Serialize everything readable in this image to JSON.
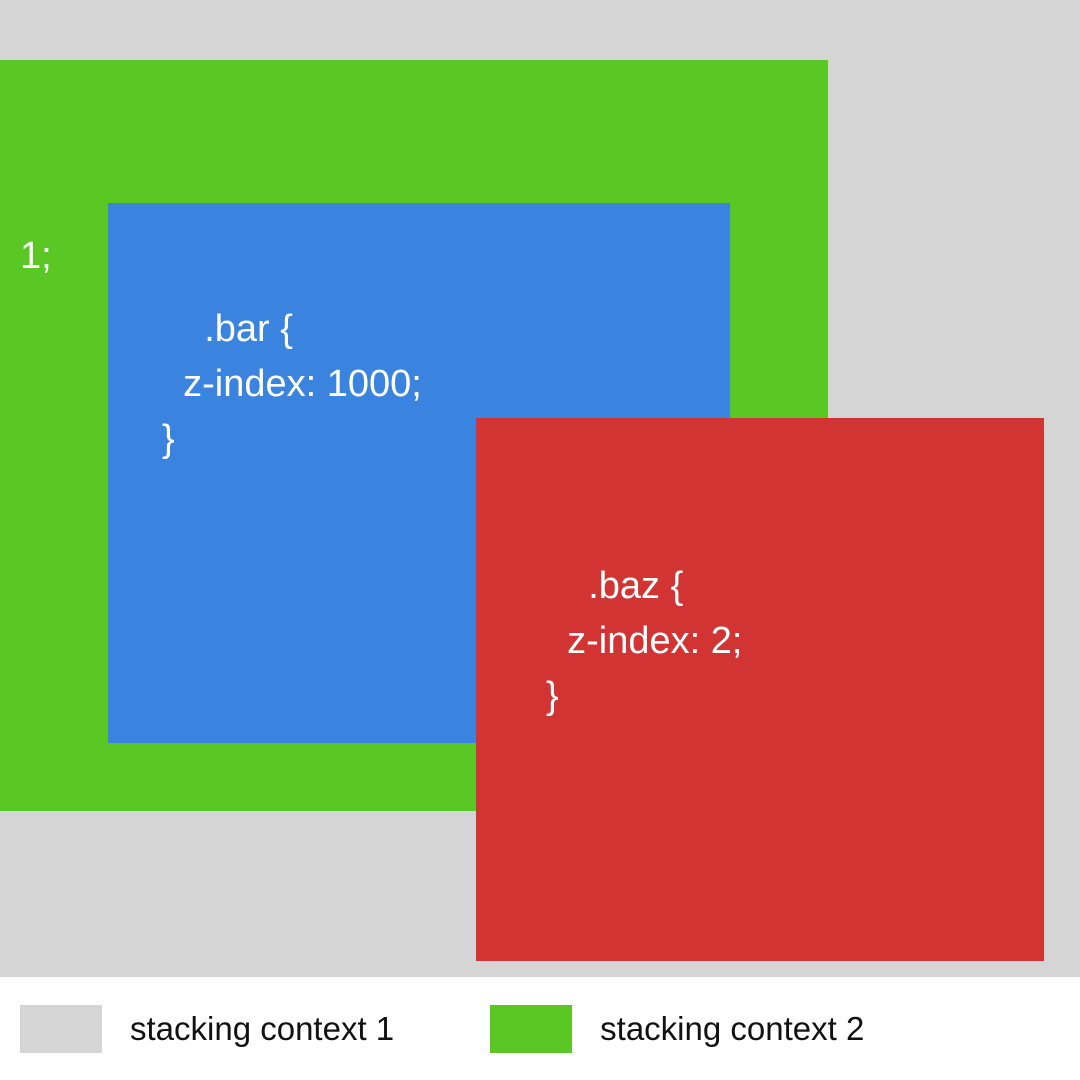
{
  "boxes": {
    "green": {
      "label": "1;"
    },
    "blue": {
      "css": ".bar {\n  z-index: 1000;\n}"
    },
    "red": {
      "css": ".baz {\n  z-index: 2;\n}"
    }
  },
  "legend": {
    "item1": "stacking context 1",
    "item2": "stacking context 2"
  },
  "colors": {
    "background": "#d5d5d5",
    "green": "#5ac724",
    "blue": "#3a84df",
    "red": "#d23434"
  }
}
